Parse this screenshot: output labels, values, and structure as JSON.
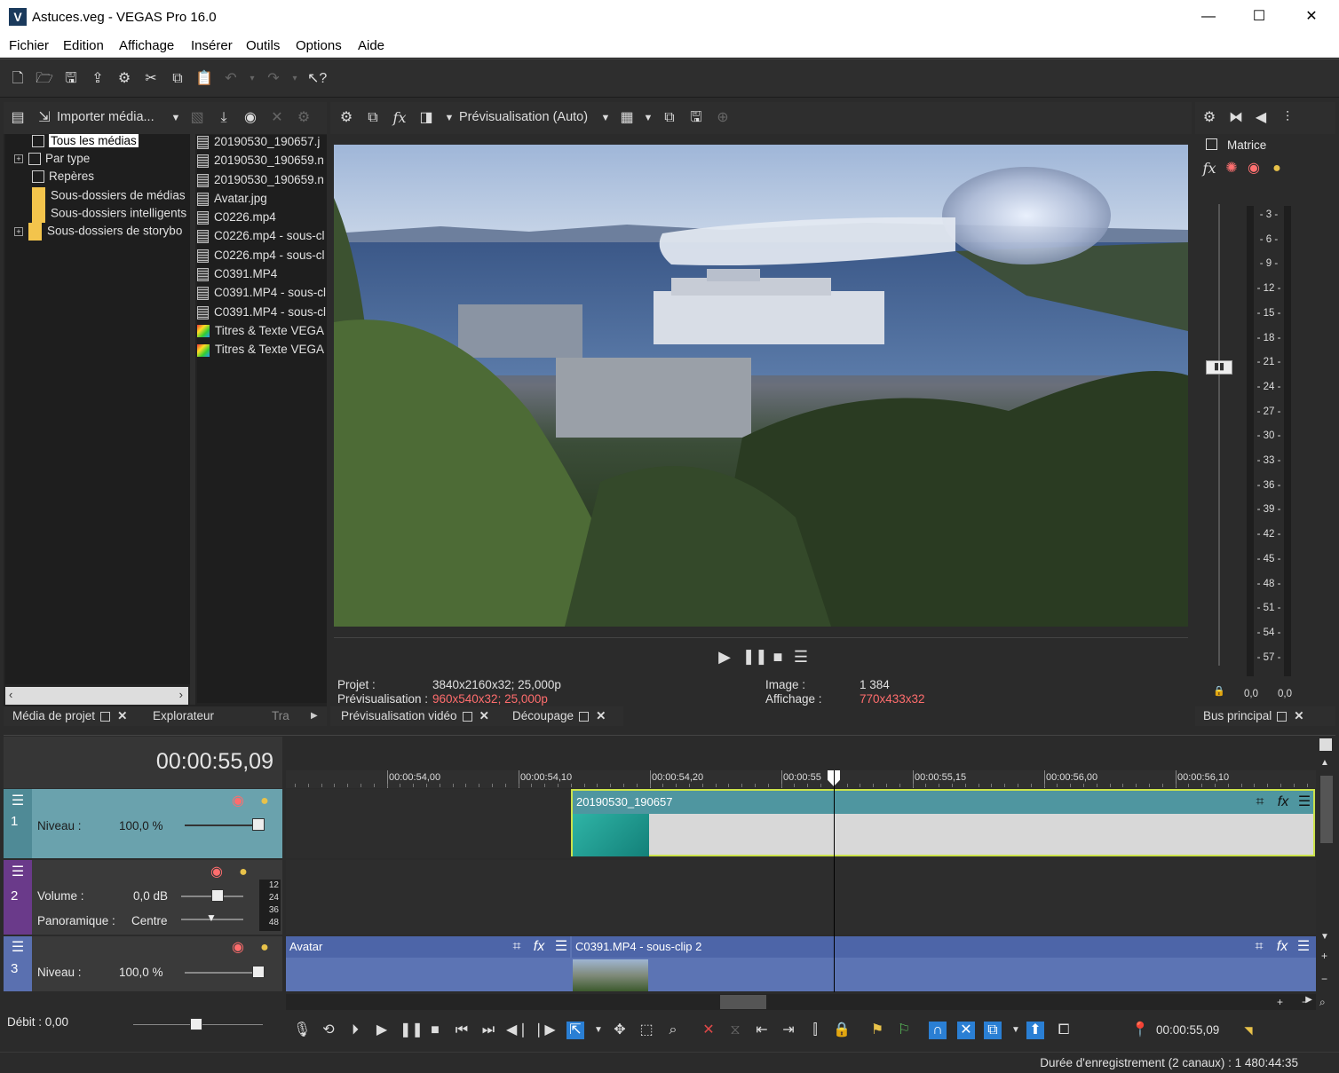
{
  "window": {
    "title": "Astuces.veg - VEGAS Pro 16.0",
    "app_icon": "V"
  },
  "menu": [
    "Fichier",
    "Edition",
    "Affichage",
    "Insérer",
    "Outils",
    "Options",
    "Aide"
  ],
  "media_panel": {
    "import_label": "Importer média...",
    "tree": [
      {
        "label": "Tous les médias",
        "selected": true,
        "expander": false,
        "icon": "media-bin-icon"
      },
      {
        "label": "Par type",
        "expander": true,
        "icon": "media-bin-icon"
      },
      {
        "label": "Repères",
        "expander": false,
        "icon": "media-bin-icon"
      },
      {
        "label": "Sous-dossiers de médias",
        "expander": false,
        "icon": "folder-icon"
      },
      {
        "label": "Sous-dossiers intelligents",
        "expander": false,
        "icon": "folder-icon"
      },
      {
        "label": "Sous-dossiers de storybo",
        "expander": true,
        "icon": "folder-icon"
      }
    ],
    "files": [
      {
        "name": "20190530_190657.j",
        "type": "video"
      },
      {
        "name": "20190530_190659.n",
        "type": "video"
      },
      {
        "name": "20190530_190659.n",
        "type": "video"
      },
      {
        "name": "Avatar.jpg",
        "type": "video"
      },
      {
        "name": "C0226.mp4",
        "type": "video"
      },
      {
        "name": "C0226.mp4 - sous-cl",
        "type": "video"
      },
      {
        "name": "C0226.mp4 - sous-cl",
        "type": "video"
      },
      {
        "name": "C0391.MP4",
        "type": "video"
      },
      {
        "name": "C0391.MP4 - sous-cl",
        "type": "video"
      },
      {
        "name": "C0391.MP4 - sous-cl",
        "type": "video"
      },
      {
        "name": "Titres & Texte VEGA",
        "type": "title"
      },
      {
        "name": "Titres & Texte VEGA",
        "type": "title"
      }
    ],
    "tabs": [
      "Média de projet",
      "Explorateur",
      "Tra"
    ]
  },
  "preview": {
    "mode_label": "Prévisualisation (Auto)",
    "info": {
      "projet_label": "Projet :",
      "projet_value": "3840x2160x32; 25,000p",
      "prev_label": "Prévisualisation :",
      "prev_value": "960x540x32; 25,000p",
      "image_label": "Image :",
      "image_value": "1 384",
      "affichage_label": "Affichage :",
      "affichage_value": "770x433x32"
    },
    "tabs": [
      "Prévisualisation vidéo",
      "Découpage"
    ]
  },
  "master_bus": {
    "matrix_label": "Matrice",
    "scale": [
      "3",
      "6",
      "9",
      "12",
      "15",
      "18",
      "21",
      "24",
      "27",
      "30",
      "33",
      "36",
      "39",
      "42",
      "45",
      "48",
      "51",
      "54",
      "57"
    ],
    "left_value": "0,0",
    "right_value": "0,0",
    "tab": "Bus principal"
  },
  "timeline": {
    "timecode": "00:00:55,09",
    "ruler": [
      "00:00:54,00",
      "00:00:54,10",
      "00:00:54,20",
      "00:00:55",
      "00:00:55,15",
      "00:00:56,00",
      "00:00:56,10"
    ],
    "tracks": [
      {
        "num": "1",
        "param_label": "Niveau :",
        "param_value": "100,0 %",
        "color": "#5b9ea6"
      },
      {
        "num": "2",
        "param_label": "Volume :",
        "param_value": "0,0 dB",
        "pan_label": "Panoramique :",
        "pan_value": "Centre",
        "color": "#6a3a8a",
        "meter": [
          "12",
          "24",
          "36",
          "48"
        ]
      },
      {
        "num": "3",
        "param_label": "Niveau :",
        "param_value": "100,0 %",
        "color": "#5a70b0"
      }
    ],
    "clips": {
      "track1": "20190530_190657",
      "track3a": "Avatar",
      "track3b": "C0391.MP4 - sous-clip 2"
    },
    "rate": "Débit : 0,00",
    "cursor_time": "00:00:55,09"
  },
  "status": {
    "text": "Durée d'enregistrement (2 canaux) : 1 480:44:35"
  }
}
